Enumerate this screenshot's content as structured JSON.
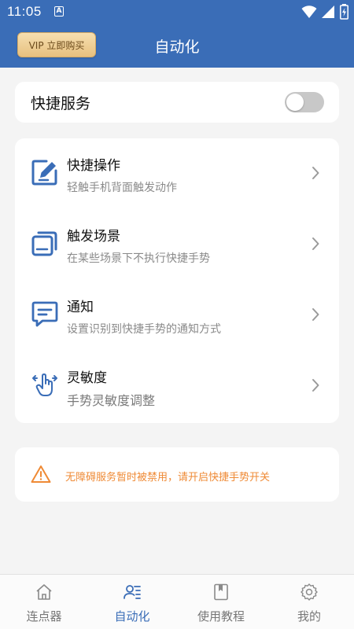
{
  "status_bar": {
    "time": "11:05",
    "notification_letter": "A"
  },
  "app_bar": {
    "vip_label": "VIP 立即购买",
    "title": "自动化"
  },
  "service": {
    "label": "快捷服务",
    "enabled": false
  },
  "menu": {
    "items": [
      {
        "title": "快捷操作",
        "subtitle": "轻触手机背面触发动作",
        "icon": "edit-icon"
      },
      {
        "title": "触发场景",
        "subtitle": "在某些场景下不执行快捷手势",
        "icon": "copy-icon"
      },
      {
        "title": "通知",
        "subtitle": "设置识别到快捷手势的通知方式",
        "icon": "message-icon"
      },
      {
        "title": "灵敏度",
        "subtitle": "手势灵敏度调整",
        "icon": "gesture-icon"
      }
    ]
  },
  "warning": {
    "text": "无障碍服务暂时被禁用，请开启快捷手势开关"
  },
  "bottom_nav": {
    "items": [
      {
        "label": "连点器",
        "icon": "home-icon"
      },
      {
        "label": "自动化",
        "icon": "automation-icon",
        "active": true
      },
      {
        "label": "使用教程",
        "icon": "book-icon"
      },
      {
        "label": "我的",
        "icon": "settings-icon"
      }
    ]
  },
  "colors": {
    "primary": "#3a6db7",
    "warning": "#ef8a35",
    "background": "#f4f4f4"
  }
}
